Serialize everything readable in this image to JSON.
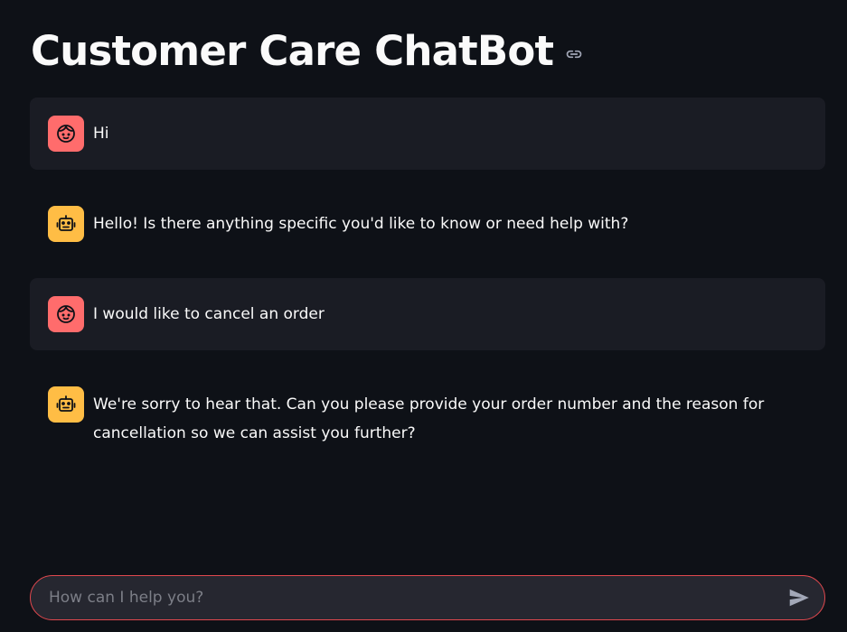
{
  "header": {
    "title": "Customer Care ChatBot",
    "anchor_icon": "link-icon"
  },
  "colors": {
    "background": "#0e1117",
    "user_message_bg": "#1a1c24",
    "user_avatar": "#ff6c6c",
    "bot_avatar": "#ffbd45",
    "input_border": "#e0484e",
    "input_bg": "#262730"
  },
  "messages": [
    {
      "role": "user",
      "avatar_icon": "user-face-icon",
      "text": "Hi"
    },
    {
      "role": "assistant",
      "avatar_icon": "robot-icon",
      "text": "Hello! Is there anything specific you'd like to know or need help with?"
    },
    {
      "role": "user",
      "avatar_icon": "user-face-icon",
      "text": "I would like to cancel an order"
    },
    {
      "role": "assistant",
      "avatar_icon": "robot-icon",
      "text": "We're sorry to hear that. Can you please provide your order number and the reason for cancellation so we can assist you further?"
    }
  ],
  "chat_input": {
    "placeholder": "How can I help you?",
    "value": "",
    "send_icon": "send-icon"
  }
}
